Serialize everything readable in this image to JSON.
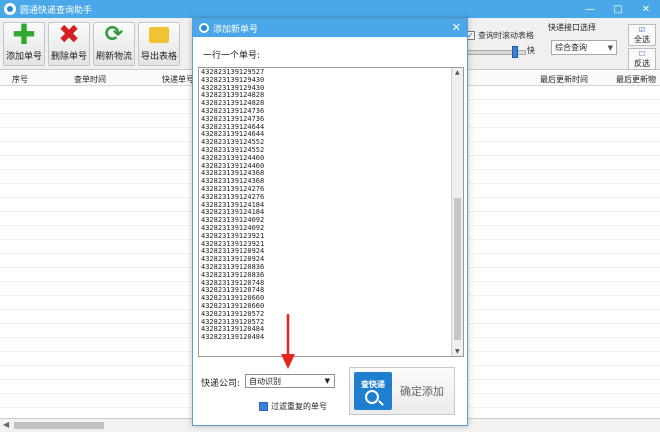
{
  "main": {
    "title": "圆通快递查询助手",
    "controls": {
      "minimize": "—",
      "maximize": "□",
      "close": "✕"
    },
    "toolbar": {
      "add": "添加单号",
      "delete": "删除单号",
      "refresh": "刷新物流",
      "export": "导出表格"
    },
    "options": {
      "scroll_label": "查询时滚动表格",
      "scroll_checked": true,
      "speed_label": "快",
      "api_label": "快递接口选择",
      "api_value": "综合查询",
      "select_all": "全选",
      "invert": "反选"
    },
    "table_headers": [
      "序号",
      "查单时间",
      "快递单号",
      "最后更新时间",
      "最后更新物流"
    ]
  },
  "dialog": {
    "title": "添加新单号",
    "per_line": "一行一个单号:",
    "tracking_numbers": [
      "432823139129527",
      "432823139129430",
      "432823139129430",
      "432823139124828",
      "432823139124828",
      "432823139124736",
      "432823139124736",
      "432823139124644",
      "432823139124644",
      "432823139124552",
      "432823139124552",
      "432823139124460",
      "432823139124460",
      "432823139124368",
      "432823139124368",
      "432823139124276",
      "432823139124276",
      "432823139124184",
      "432823139124184",
      "432823139124092",
      "432823139124092",
      "432823139123921",
      "432823139123921",
      "432823139120924",
      "432823139120924",
      "432823139120836",
      "432823139120836",
      "432823139120748",
      "432823139120748",
      "432823139120660",
      "432823139120660",
      "432823139120572",
      "432823139120572",
      "432823139120484",
      "432823139120484"
    ],
    "courier_label": "快递公司:",
    "courier_value": "自动识别",
    "filter_label": "过滤重复的单号",
    "filter_checked": true,
    "logo_text": "查快递",
    "confirm": "确定添加",
    "close": "✕"
  }
}
